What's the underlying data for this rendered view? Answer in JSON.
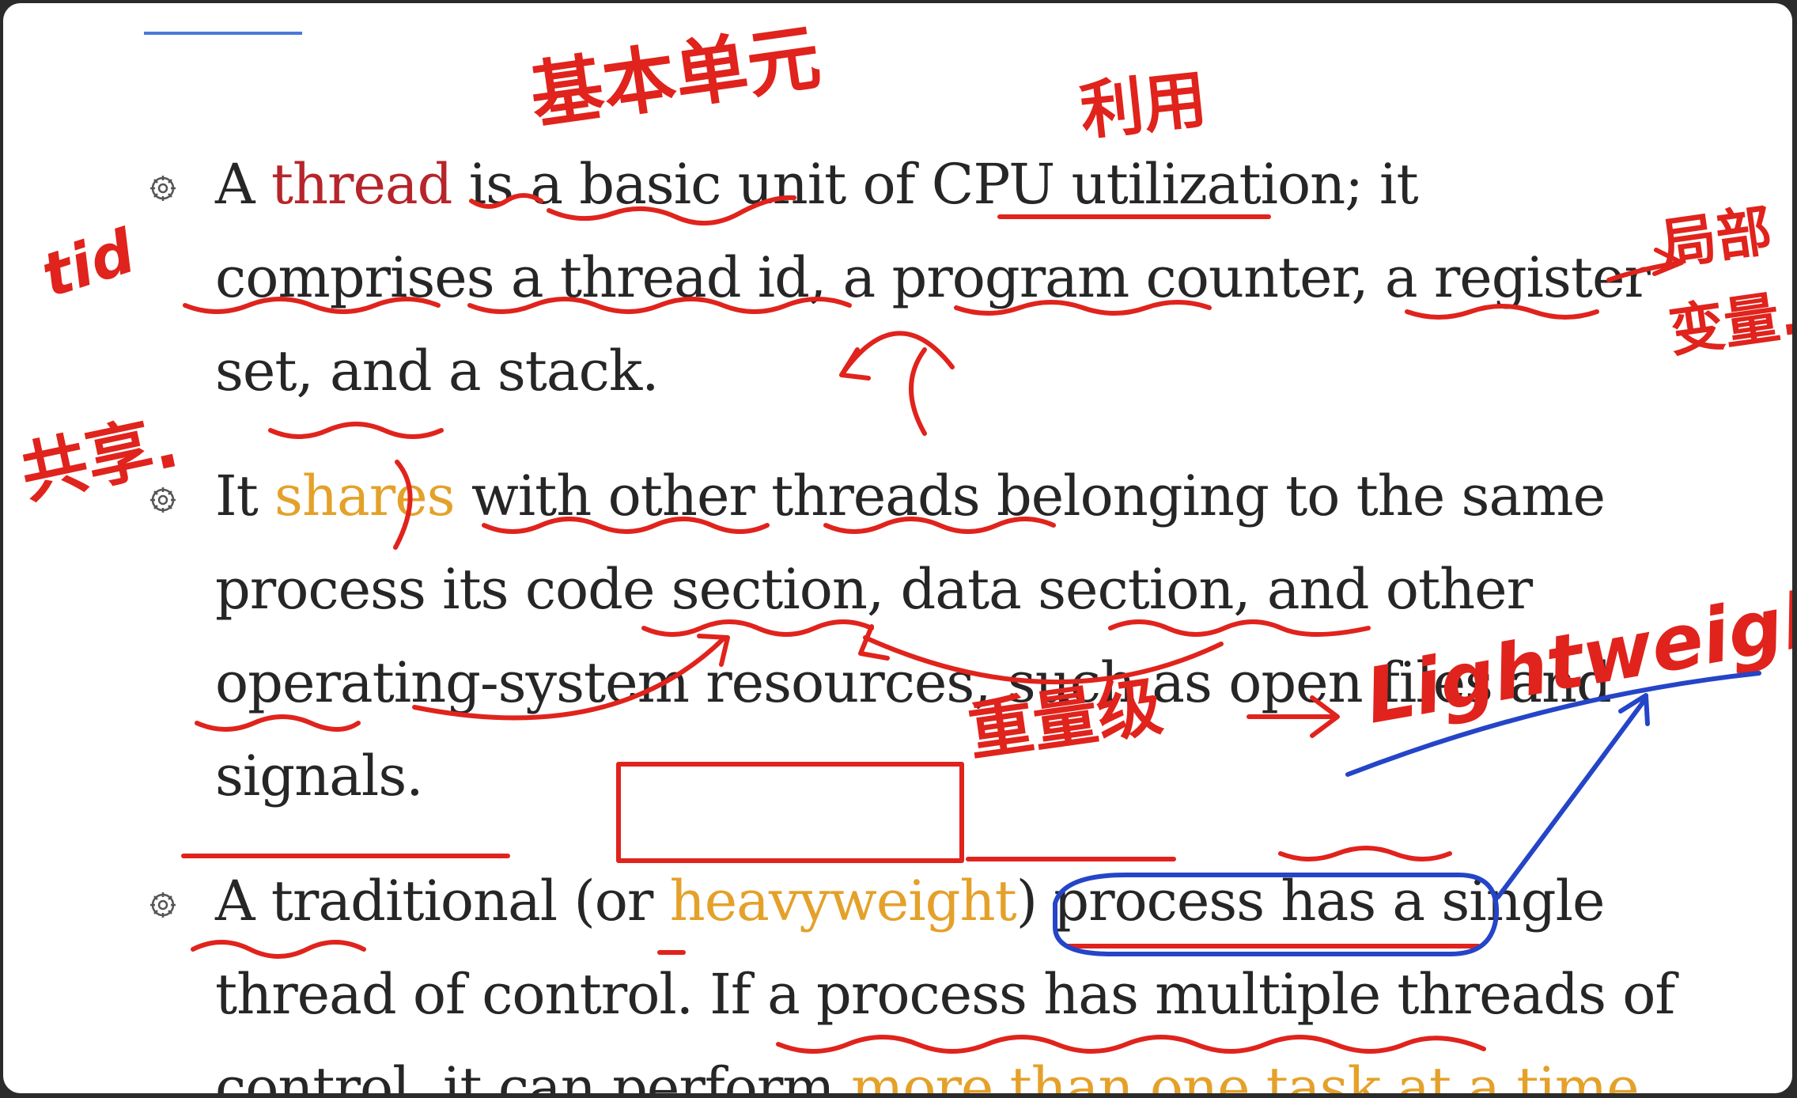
{
  "slide": {
    "bullets": [
      {
        "parts": [
          {
            "text": "A ",
            "style": "plain"
          },
          {
            "text": "thread",
            "style": "red"
          },
          {
            "text": " is a basic unit of CPU utilization; it comprises a thread id, a program counter, a register set, and a stack.",
            "style": "plain"
          }
        ]
      },
      {
        "parts": [
          {
            "text": "It ",
            "style": "plain"
          },
          {
            "text": "shares",
            "style": "orange"
          },
          {
            "text": " with other threads belonging to the same process its code section, data section, and other operating-system resources, such as open files and signals.",
            "style": "plain"
          }
        ]
      },
      {
        "parts": [
          {
            "text": "A traditional (or ",
            "style": "plain"
          },
          {
            "text": "heavyweight",
            "style": "orange"
          },
          {
            "text": ") process has a single thread of control. If a process has multiple threads of control, it can perform ",
            "style": "plain"
          },
          {
            "text": "more than one task at a time",
            "style": "orange"
          },
          {
            "text": ".",
            "style": "plain"
          }
        ]
      }
    ]
  },
  "annotations": {
    "basic_unit": "基本单元",
    "utilization": "利用",
    "tid": "tid",
    "local_variable_1": "局部",
    "local_variable_2": "变量.",
    "shared": "共享.",
    "heavyweight": "重量级",
    "lightweight": "Lightweight"
  },
  "colors": {
    "keyword_red": "#b5252b",
    "keyword_orange": "#e4a12a",
    "ink_red": "#e0231c",
    "ink_blue": "#2445c8",
    "accent_rule": "#4a78d8"
  },
  "icons": {
    "bullet": "gear-bullet-icon"
  }
}
